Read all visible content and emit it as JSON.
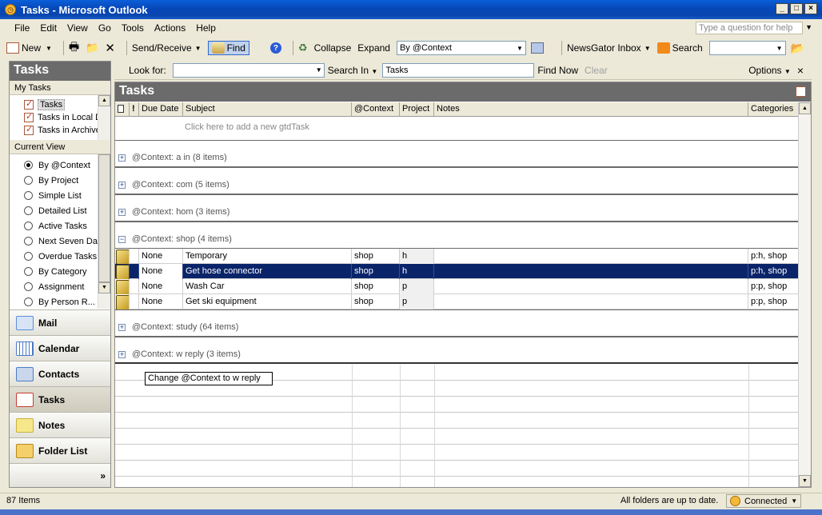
{
  "window": {
    "title": "Tasks - Microsoft Outlook"
  },
  "menu": [
    "File",
    "Edit",
    "View",
    "Go",
    "Tools",
    "Actions",
    "Help"
  ],
  "help_box": {
    "placeholder": "Type a question for help"
  },
  "toolbar": {
    "new": "New",
    "send_receive": "Send/Receive",
    "find": "Find",
    "collapse": "Collapse",
    "expand": "Expand",
    "view_combo": "By @Context",
    "newsgator": "NewsGator Inbox",
    "search": "Search"
  },
  "nav": {
    "title": "Tasks",
    "my_tasks_header": "My Tasks",
    "folders": [
      "Tasks",
      "Tasks in Local D",
      "Tasks in Archive"
    ],
    "current_view_header": "Current View",
    "views": [
      "By @Context",
      "By Project",
      "Simple List",
      "Detailed List",
      "Active Tasks",
      "Next Seven Day",
      "Overdue Tasks",
      "By Category",
      "Assignment",
      "By Person R..."
    ],
    "selected_view": 0,
    "buttons": [
      {
        "label": "Mail",
        "icon": "mail-icon",
        "color": "#5a8fd8"
      },
      {
        "label": "Calendar",
        "icon": "calendar-icon",
        "color": "#4b78c8"
      },
      {
        "label": "Contacts",
        "icon": "contacts-icon",
        "color": "#4a7fc8"
      },
      {
        "label": "Tasks",
        "icon": "tasks-icon",
        "color": "#c83c2c"
      },
      {
        "label": "Notes",
        "icon": "notes-icon",
        "color": "#e8d24a"
      },
      {
        "label": "Folder List",
        "icon": "folder-icon",
        "color": "#e5b83c"
      }
    ],
    "more": "»"
  },
  "findbar": {
    "look_for_label": "Look for:",
    "look_for_value": "",
    "search_in": "Search In",
    "search_in_value": "Tasks",
    "find_now": "Find Now",
    "clear": "Clear",
    "options": "Options",
    "close": "×"
  },
  "main": {
    "title": "Tasks",
    "columns": [
      "Due Date",
      "Subject",
      "@Context",
      "Project",
      "Notes",
      "Categories"
    ],
    "add_row": "Click here to add a new gtdTask",
    "groups_before": [
      "@Context: a in (8 items)",
      "@Context: com (5 items)",
      "@Context: hom (3 items)",
      "@Context: shop (4 items)"
    ],
    "rows": [
      {
        "due": "None",
        "subject": "Temporary",
        "context": "shop",
        "project": "h",
        "notes": "",
        "categories": "p:h, shop"
      },
      {
        "due": "None",
        "subject": "Get hose connector",
        "context": "shop",
        "project": "h",
        "notes": "",
        "categories": "p:h, shop"
      },
      {
        "due": "None",
        "subject": "Wash Car",
        "context": "shop",
        "project": "p",
        "notes": "",
        "categories": "p:p, shop"
      },
      {
        "due": "None",
        "subject": "Get ski equipment",
        "context": "shop",
        "project": "p",
        "notes": "",
        "categories": "p:p, shop"
      }
    ],
    "selected_row": 1,
    "groups_after": [
      "@Context: study (64 items)",
      "@Context: w reply (3 items)"
    ],
    "tooltip": "Change @Context to w reply"
  },
  "status": {
    "items": "87 Items",
    "sync": "All folders are up to date.",
    "connection": "Connected"
  }
}
